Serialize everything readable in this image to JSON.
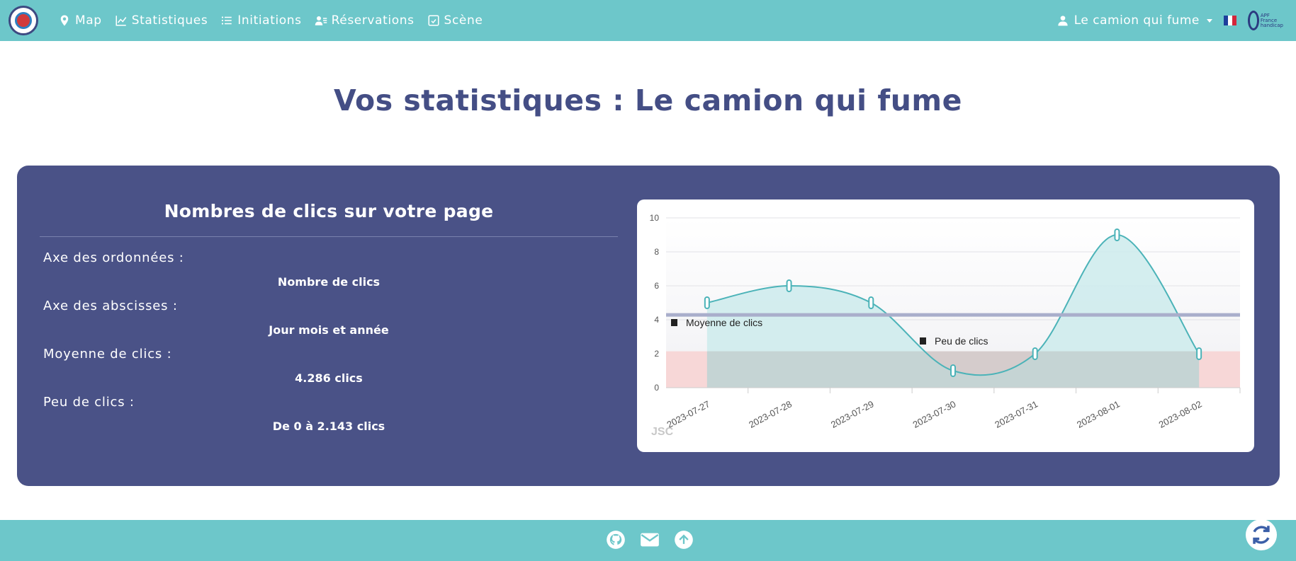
{
  "nav": {
    "items": [
      {
        "label": "Map",
        "icon": "map-pin-icon"
      },
      {
        "label": "Statistiques",
        "icon": "chart-line-icon"
      },
      {
        "label": "Initiations",
        "icon": "list-icon"
      },
      {
        "label": "Réservations",
        "icon": "user-list-icon"
      },
      {
        "label": "Scène",
        "icon": "calendar-check-icon"
      }
    ],
    "user": "Le camion qui fume",
    "language_flag": "FR",
    "brand_text": [
      "APF",
      "France",
      "handicap"
    ]
  },
  "page": {
    "title": "Vos statistiques : Le camion qui fume"
  },
  "stats": {
    "heading": "Nombres de clics sur votre page",
    "y_axis_label": "Axe des ordonnées :",
    "y_axis_value": "Nombre de clics",
    "x_axis_label": "Axe des abscisses :",
    "x_axis_value": "Jour mois et année",
    "average_label": "Moyenne de clics :",
    "average_value": "4.286 clics",
    "low_label": "Peu de clics :",
    "low_value": "De 0 à 2.143 clics"
  },
  "chart_data": {
    "type": "area",
    "categories": [
      "2023-07-27",
      "2023-07-28",
      "2023-07-29",
      "2023-07-30",
      "2023-07-31",
      "2023-08-01",
      "2023-08-02"
    ],
    "values": [
      5,
      6,
      5,
      1,
      2,
      9,
      2
    ],
    "ylim": [
      0,
      10
    ],
    "yticks": [
      0,
      2,
      4,
      6,
      8,
      10
    ],
    "average": 4.286,
    "low_threshold": 2.143,
    "annotations": [
      "Moyenne de clics",
      "Peu de clics"
    ],
    "watermark": "JSC",
    "colors": {
      "line": "#4bb3b8",
      "fill": "#cdebec",
      "average": "#a9aecb",
      "low_band": "#f7d7d7"
    }
  },
  "colors": {
    "navbar": "#6dc7ca",
    "title": "#444e85",
    "panel": "#4a5287"
  }
}
